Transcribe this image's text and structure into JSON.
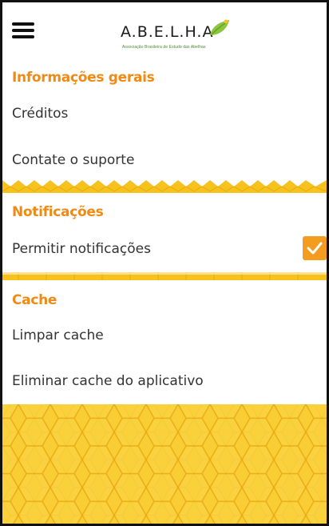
{
  "header": {
    "logo_text": "A.B.E.L.H.A",
    "logo_subtitle": "Associação Brasileira de Estudo das Abelhas",
    "menu_icon": "hamburger-menu-icon"
  },
  "sections": {
    "general": {
      "title": "Informações gerais",
      "items": [
        "Créditos",
        "Contate o suporte"
      ]
    },
    "notifications": {
      "title": "Notificações",
      "toggle_label": "Permitir notificações",
      "toggle_checked": true
    },
    "cache": {
      "title": "Cache",
      "items": [
        "Limpar cache",
        "Eliminar cache do aplicativo"
      ]
    }
  },
  "colors": {
    "accent": "#f08a12",
    "honey": "#f7c21e",
    "honey_dark": "#e9a90f",
    "checkbox": "#f39c1f"
  }
}
